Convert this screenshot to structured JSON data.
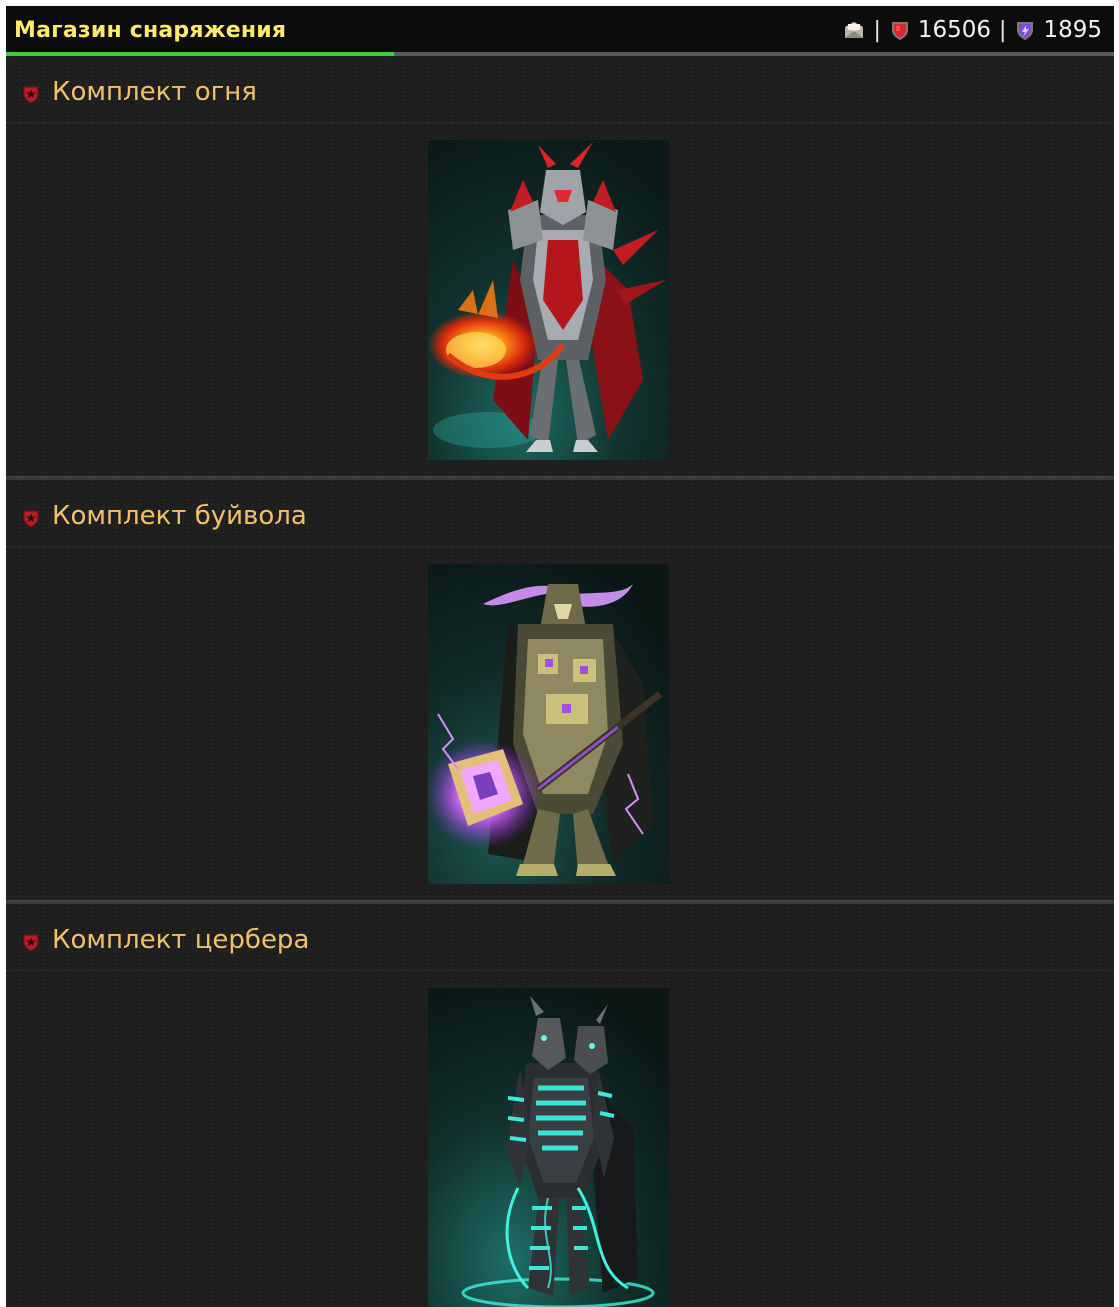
{
  "header": {
    "title": "Магазин снаряжения",
    "separator": "|",
    "mail_icon": "mail-envelope-icon",
    "health_icon": "red-shield-icon",
    "health_value": "16506",
    "mana_icon": "purple-shield-icon",
    "mana_value": "1895",
    "progress_fraction": 0.35
  },
  "sections": [
    {
      "label": "Комплект огня",
      "bullet_icon": "emblem-bullet-icon",
      "image": "fire-armor-set-portrait"
    },
    {
      "label": "Комплект буйвола",
      "bullet_icon": "emblem-bullet-icon",
      "image": "buffalo-armor-set-portrait"
    },
    {
      "label": "Комплект цербера",
      "bullet_icon": "emblem-bullet-icon",
      "image": "cerberus-armor-set-portrait"
    }
  ],
  "colors": {
    "title": "#ffe96b",
    "section_label": "#f0c169",
    "progress": "#3fce3f",
    "background": "#1f1f1f"
  }
}
